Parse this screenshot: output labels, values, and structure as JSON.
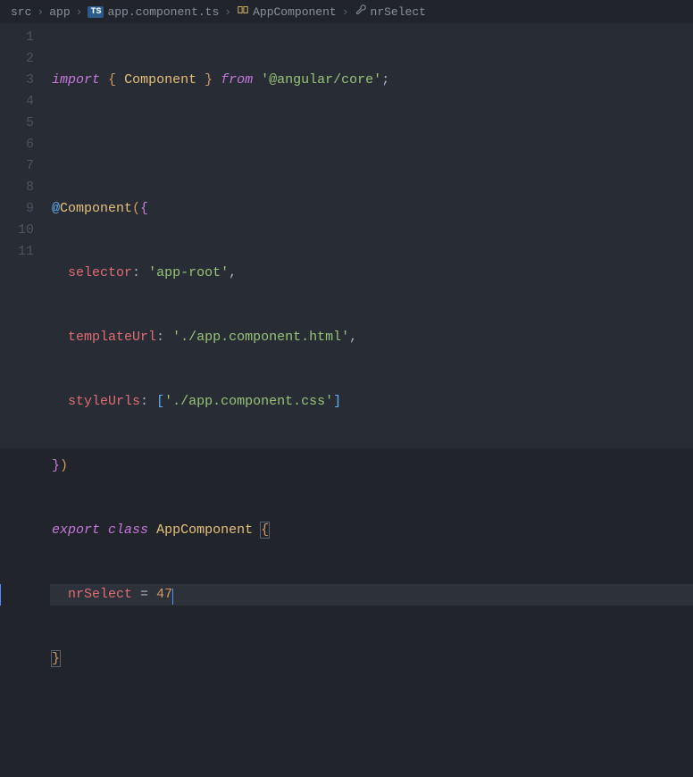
{
  "breadcrumb": {
    "items": [
      {
        "label": "src",
        "iconType": "none"
      },
      {
        "label": "app",
        "iconType": "none"
      },
      {
        "label": "app.component.ts",
        "iconType": "ts"
      },
      {
        "label": "AppComponent",
        "iconType": "class"
      },
      {
        "label": "nrSelect",
        "iconType": "wrench"
      }
    ]
  },
  "chevron": "›",
  "code": {
    "lines": [
      "1",
      "2",
      "3",
      "4",
      "5",
      "6",
      "7",
      "8",
      "9",
      "10",
      "11"
    ],
    "l1": {
      "import": "import",
      "lb": "{",
      "comp": "Component",
      "rb": "}",
      "from": "from",
      "str": "'@angular/core'",
      "semi": ";"
    },
    "l3": {
      "at": "@",
      "dec": "Component",
      "lp": "(",
      "lb": "{"
    },
    "l4": {
      "key": "selector",
      "colon": ":",
      "val": "'app-root'",
      "comma": ","
    },
    "l5": {
      "key": "templateUrl",
      "colon": ":",
      "val": "'./app.component.html'",
      "comma": ","
    },
    "l6": {
      "key": "styleUrls",
      "colon": ":",
      "lb": "[",
      "val": "'./app.component.css'",
      "rb": "]"
    },
    "l7": {
      "rb": "}",
      "rp": ")"
    },
    "l8": {
      "export": "export",
      "class": "class",
      "name": "AppComponent",
      "lb": "{"
    },
    "l9": {
      "var": "nrSelect",
      "eq": "=",
      "num": "47"
    },
    "l10": {
      "rb": "}"
    }
  }
}
